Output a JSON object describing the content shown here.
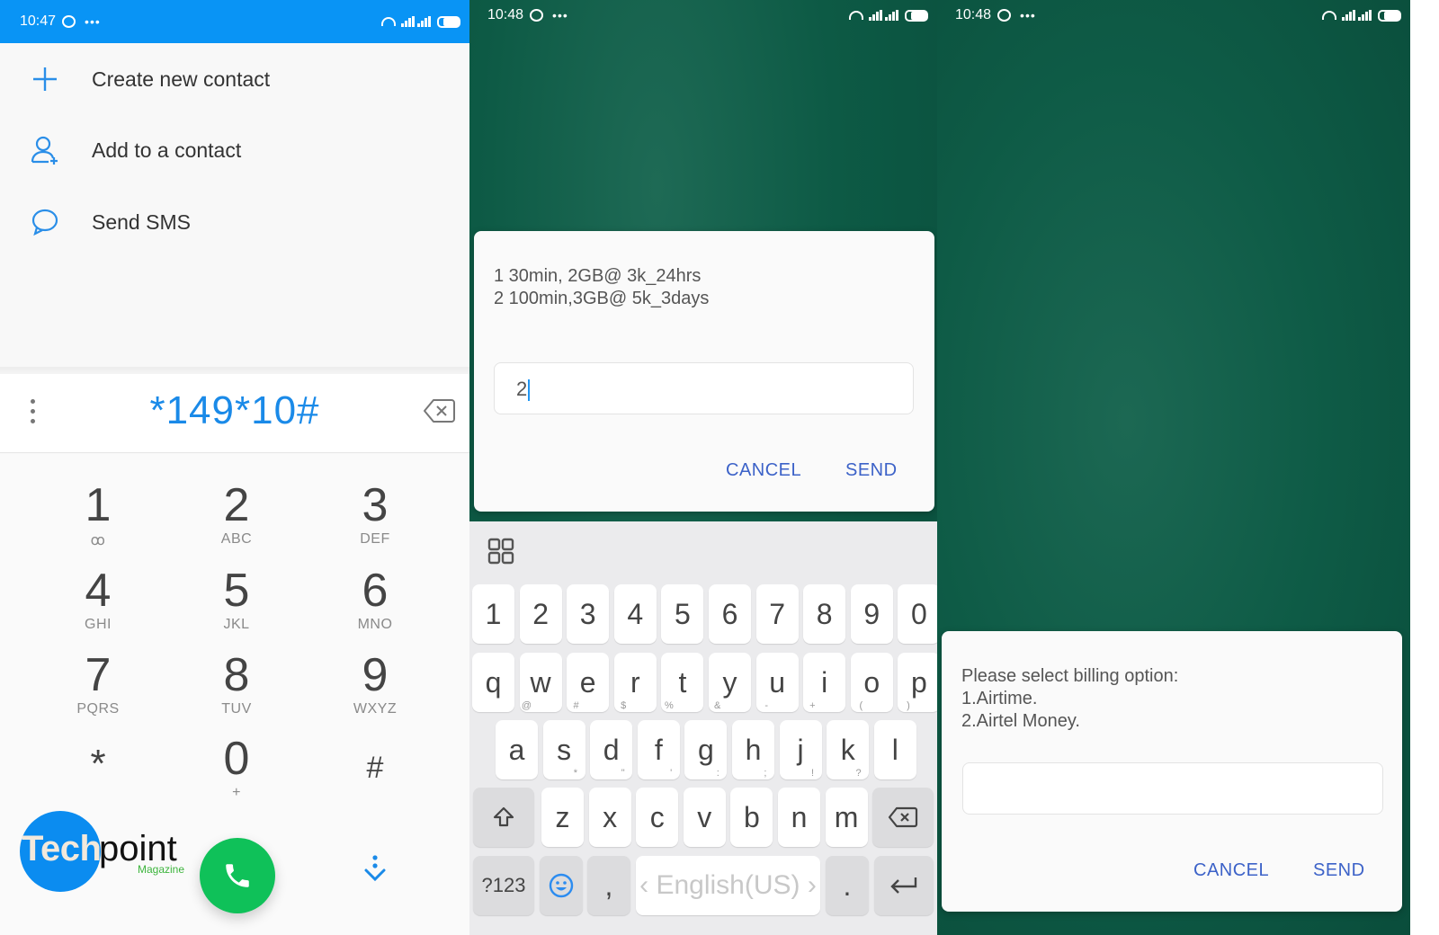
{
  "panel1": {
    "status": {
      "time": "10:47",
      "bg": "#0994f5"
    },
    "menu": [
      {
        "label": "Create new contact",
        "icon": "plus-icon"
      },
      {
        "label": "Add to a contact",
        "icon": "add-person-icon"
      },
      {
        "label": "Send SMS",
        "icon": "chat-bubble-icon"
      }
    ],
    "dialed_number": "*149*10#",
    "keypad": [
      {
        "digit": "1",
        "sub": "ꝏ"
      },
      {
        "digit": "2",
        "sub": "ABC"
      },
      {
        "digit": "3",
        "sub": "DEF"
      },
      {
        "digit": "4",
        "sub": "GHI"
      },
      {
        "digit": "5",
        "sub": "JKL"
      },
      {
        "digit": "6",
        "sub": "MNO"
      },
      {
        "digit": "7",
        "sub": "PQRS"
      },
      {
        "digit": "8",
        "sub": "TUV"
      },
      {
        "digit": "9",
        "sub": "WXYZ"
      },
      {
        "digit": "*",
        "sub": ""
      },
      {
        "digit": "0",
        "sub": "+"
      },
      {
        "digit": "#",
        "sub": ""
      }
    ],
    "logo": {
      "tech": "Tech",
      "point": "point",
      "magazine": "Magazine"
    },
    "call_color": "#0fc159",
    "accent": "#1a8ae8"
  },
  "panel2": {
    "status": {
      "time": "10:48"
    },
    "dialog": {
      "message": "1 30min, 2GB@ 3k_24hrs\n2 100min,3GB@ 5k_3days",
      "input_value": "2",
      "cancel": "CANCEL",
      "send": "SEND"
    },
    "keyboard": {
      "row_numbers": [
        "1",
        "2",
        "3",
        "4",
        "5",
        "6",
        "7",
        "8",
        "9",
        "0"
      ],
      "row_qwerty": [
        "q",
        "w",
        "e",
        "r",
        "t",
        "y",
        "u",
        "i",
        "o",
        "p"
      ],
      "row_asdf": [
        {
          "k": "a",
          "alt": "@"
        },
        {
          "k": "s",
          "alt": "#"
        },
        {
          "k": "d",
          "alt": "$"
        },
        {
          "k": "f",
          "alt": "%"
        },
        {
          "k": "g",
          "alt": "&"
        },
        {
          "k": "h",
          "alt": "-"
        },
        {
          "k": "j",
          "alt": "+"
        },
        {
          "k": "k",
          "alt": "("
        },
        {
          "k": "l",
          "alt": ")"
        }
      ],
      "row_zxcv": [
        {
          "k": "z",
          "alt": "*"
        },
        {
          "k": "x",
          "alt": "\""
        },
        {
          "k": "c",
          "alt": "'"
        },
        {
          "k": "v",
          "alt": ":"
        },
        {
          "k": "b",
          "alt": ";"
        },
        {
          "k": "n",
          "alt": "!"
        },
        {
          "k": "m",
          "alt": "?"
        }
      ],
      "symbols_label": "?123",
      "comma": ",",
      "space_label": "‹ English(US) ›",
      "period": "."
    }
  },
  "panel3": {
    "status": {
      "time": "10:48"
    },
    "dialog": {
      "message": "Please select billing option:\n1.Airtime.\n2.Airtel Money.",
      "input_value": "",
      "cancel": "CANCEL",
      "send": "SEND"
    }
  }
}
